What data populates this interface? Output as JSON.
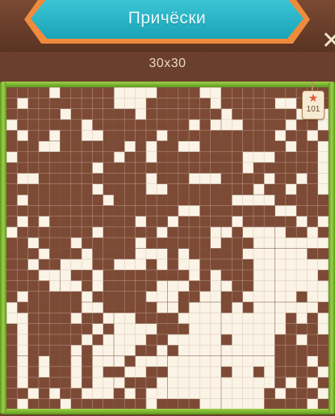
{
  "header": {
    "title": "Причёски",
    "close_symbol": "✕"
  },
  "puzzle": {
    "size_label": "30x30",
    "rows": 30,
    "cols": 30,
    "filled_color": "#7d4a35",
    "empty_color": "#fbf3e6",
    "grid_line_color": "#c9b9a6",
    "major_line_color": "#7a5a45",
    "tag": {
      "icon": "star-icon",
      "number": "101"
    },
    "grid": [
      "111101111100001111001111111111",
      "101111111100011111101111100111",
      "111110111111011111110111111010",
      "011111101111111110100011110110",
      "101101100111110111111111101101",
      "111001111110101100111111110110",
      "011111111101101111111100011110",
      "111111110111111111111101111110",
      "100111111111101110001111011010",
      "111111110111100111111110110110",
      "101111111011111111111000011111",
      "111111111111111100111111100111",
      "101011111111011011111011111010",
      "011111110111110111100100001101",
      "110111011111011111101110000000",
      "111011101111000101111100000011",
      "110110001100010100111110000000",
      "111000110111111110101110000001",
      "111100010111110001100110000000",
      "101111101111100011001100000100",
      "011111100111110010001010000001",
      "001111011000111100000000001010",
      "101111110100001110000000001110",
      "101111101000011000001000011011",
      "101111010000110100000000011111",
      "101011010001000000000000011101",
      "101011010110011000001001011110",
      "101111010001110000000000010101",
      "110101100010100000000000101110",
      "101110111111101111000000111101"
    ]
  }
}
